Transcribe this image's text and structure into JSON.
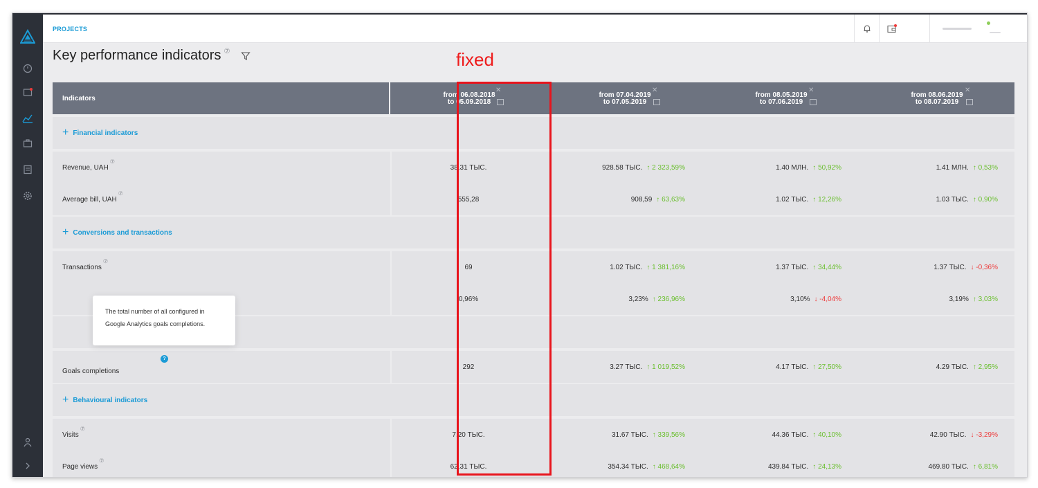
{
  "header": {
    "breadcrumb": "PROJECTS",
    "title": "Key performance indicators",
    "help_mark": "⑦"
  },
  "annotation": {
    "label": "fixed",
    "color": "#e8141c"
  },
  "colors": {
    "accent": "#1b9bd6",
    "sidebar": "#2c3038",
    "table_header": "#6d7380",
    "up": "#6abf2e",
    "down": "#ee3b3b"
  },
  "sidebar_icons": [
    "logo-icon",
    "dashboard-icon",
    "wallet-icon",
    "chart-icon",
    "briefcase-icon",
    "calculator-icon",
    "settings-icon",
    "users-icon",
    "expand-icon"
  ],
  "table": {
    "indicators_header": "Indicators",
    "periods": [
      {
        "from": "from 06.08.2018",
        "to": "to   05.09.2018"
      },
      {
        "from": "from 07.04.2019",
        "to": "to   07.05.2019"
      },
      {
        "from": "from 08.05.2019",
        "to": "to   07.06.2019"
      },
      {
        "from": "from 08.06.2019",
        "to": "to   08.07.2019"
      }
    ],
    "sections": {
      "financial": "Financial indicators",
      "conversions": "Conversions and transactions",
      "behavioural": "Behavioural indicators"
    },
    "rows": {
      "revenue": {
        "label": "Revenue, UAH",
        "base": "38.31 ТЫС.",
        "v1": "928.58 ТЫС.",
        "c1": "↑ 2 323,59%",
        "v2": "1.40 МЛН.",
        "c2": "↑ 50,92%",
        "v3": "1.41 МЛН.",
        "c3": "↑ 0,53%"
      },
      "avg_bill": {
        "label": "Average bill, UAH",
        "base": "555,28",
        "v1": "908,59",
        "c1": "↑ 63,63%",
        "v2": "1.02 ТЫС.",
        "c2": "↑ 12,26%",
        "v3": "1.03 ТЫС.",
        "c3": "↑ 0,90%"
      },
      "transactions": {
        "label": "Transactions",
        "base": "69",
        "v1": "1.02 ТЫС.",
        "c1": "↑ 1 381,16%",
        "v2": "1.37 ТЫС.",
        "c2": "↑ 34,44%",
        "v3": "1.37 ТЫС.",
        "c3": "↓ -0,36%"
      },
      "conversion": {
        "label": "",
        "base": "0,96%",
        "v1": "3,23%",
        "c1": "↑ 236,96%",
        "v2": "3,10%",
        "c2": "↓ -4,04%",
        "v3": "3,19%",
        "c3": "↑ 3,03%"
      },
      "goals": {
        "label": "Goals completions",
        "base": "292",
        "v1": "3.27 ТЫС.",
        "c1": "↑ 1 019,52%",
        "v2": "4.17 ТЫС.",
        "c2": "↑ 27,50%",
        "v3": "4.29 ТЫС.",
        "c3": "↑ 2,95%"
      },
      "visits": {
        "label": "Visits",
        "base": "7.20 ТЫС.",
        "v1": "31.67 ТЫС.",
        "c1": "↑ 339,56%",
        "v2": "44.36 ТЫС.",
        "c2": "↑ 40,10%",
        "v3": "42.90 ТЫС.",
        "c3": "↓ -3,29%"
      },
      "page_views": {
        "label": "Page views",
        "base": "62.31 ТЫС.",
        "v1": "354.34 ТЫС.",
        "c1": "↑ 468,64%",
        "v2": "439.84 ТЫС.",
        "c2": "↑ 24,13%",
        "v3": "469.80 ТЫС.",
        "c3": "↑ 6,81%"
      }
    }
  },
  "tooltip": {
    "line1": "The total number of all configured in",
    "line2": "Google Analytics goals completions."
  }
}
